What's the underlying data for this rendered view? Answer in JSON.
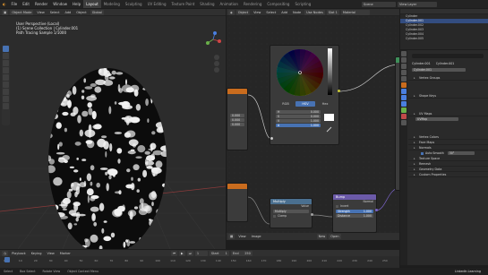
{
  "menubar": {
    "items": [
      "File",
      "Edit",
      "Render",
      "Window",
      "Help"
    ],
    "workspaces": [
      "Layout",
      "Modeling",
      "Sculpting",
      "UV Editing",
      "Texture Paint",
      "Shading",
      "Animation",
      "Rendering",
      "Compositing",
      "Scripting"
    ],
    "active_workspace": "Layout",
    "scene": "Scene",
    "view_layer": "View Layer"
  },
  "viewport": {
    "header": {
      "mode": "Object Mode",
      "menus": [
        "View",
        "Select",
        "Add",
        "Object"
      ],
      "transform": "Global"
    },
    "overlay": {
      "line1": "User Perspective (Local)",
      "line2": "(1) Scene Collection | Cylinder.001",
      "line3": "Path Tracing Sample 1/1000"
    }
  },
  "node_editor": {
    "header": {
      "menus": [
        "View",
        "Select",
        "Add",
        "Node"
      ],
      "use_nodes": "Use Nodes",
      "slot": "Slot 1",
      "material": "Material"
    },
    "color_picker": {
      "tabs": [
        "RGB",
        "HSV",
        "Hex"
      ],
      "active_tab": "HSV",
      "h_label": "H",
      "h": "0.000",
      "s_label": "S",
      "s": "0.000",
      "v_label": "V",
      "v": "1.000",
      "a_label": "A",
      "a": "1.000"
    },
    "left_values": [
      "0.000",
      "0.000",
      "0.000",
      "0.000"
    ],
    "bump_node": {
      "title": "Bump",
      "inputs": [
        "Invert",
        "Strength",
        "Distance"
      ],
      "output": "Normal",
      "strength": "1.000",
      "distance": "1.000"
    },
    "mix_node": {
      "title": "Multiply",
      "output": "Value",
      "operation": "Multiply",
      "clamp": "Clamp"
    },
    "bottom_header": {
      "menus": [
        "View",
        "Image"
      ],
      "image_name": "New",
      "open": "Open"
    }
  },
  "outliner": {
    "items": [
      "Cylinder",
      "Cylinder.001",
      "Cylinder.002",
      "Cylinder.003",
      "Cylinder.004",
      "Cylinder.005"
    ]
  },
  "properties": {
    "breadcrumb_a": "Cylinder.001",
    "breadcrumb_b": "Cylinder.001",
    "datablock": "Cylinder.001",
    "panels": [
      "Vertex Groups",
      "Shape Keys",
      "UV Maps",
      "Vertex Colors",
      "Face Maps",
      "Normals",
      "Texture Space",
      "Remesh",
      "Geometry Data",
      "Custom Properties"
    ],
    "uvmap": "UVMap",
    "autosmooth_label": "Auto Smooth",
    "autosmooth_value": "30°"
  },
  "timeline": {
    "menus": [
      "Playback",
      "Keying",
      "View",
      "Marker"
    ],
    "current_frame": "1",
    "start_label": "Start",
    "start": "1",
    "end_label": "End",
    "end": "250",
    "ticks": [
      "0",
      "10",
      "20",
      "30",
      "40",
      "50",
      "60",
      "70",
      "80",
      "90",
      "100",
      "110",
      "120",
      "130",
      "140",
      "150",
      "160",
      "170",
      "180",
      "190",
      "200",
      "210",
      "220",
      "230",
      "240",
      "250"
    ]
  },
  "statusbar": {
    "select": "Select",
    "box": "Box Select",
    "rotate": "Rotate View",
    "menu": "Object Context Menu",
    "watermark": "LinkedIn Learning"
  },
  "colors": {
    "accent": "#4772b3",
    "orange_header": "#c96c1e",
    "blue_header": "#4a6f8f",
    "purple_header": "#6b5aa8",
    "cyan_header": "#3f8fa8"
  }
}
